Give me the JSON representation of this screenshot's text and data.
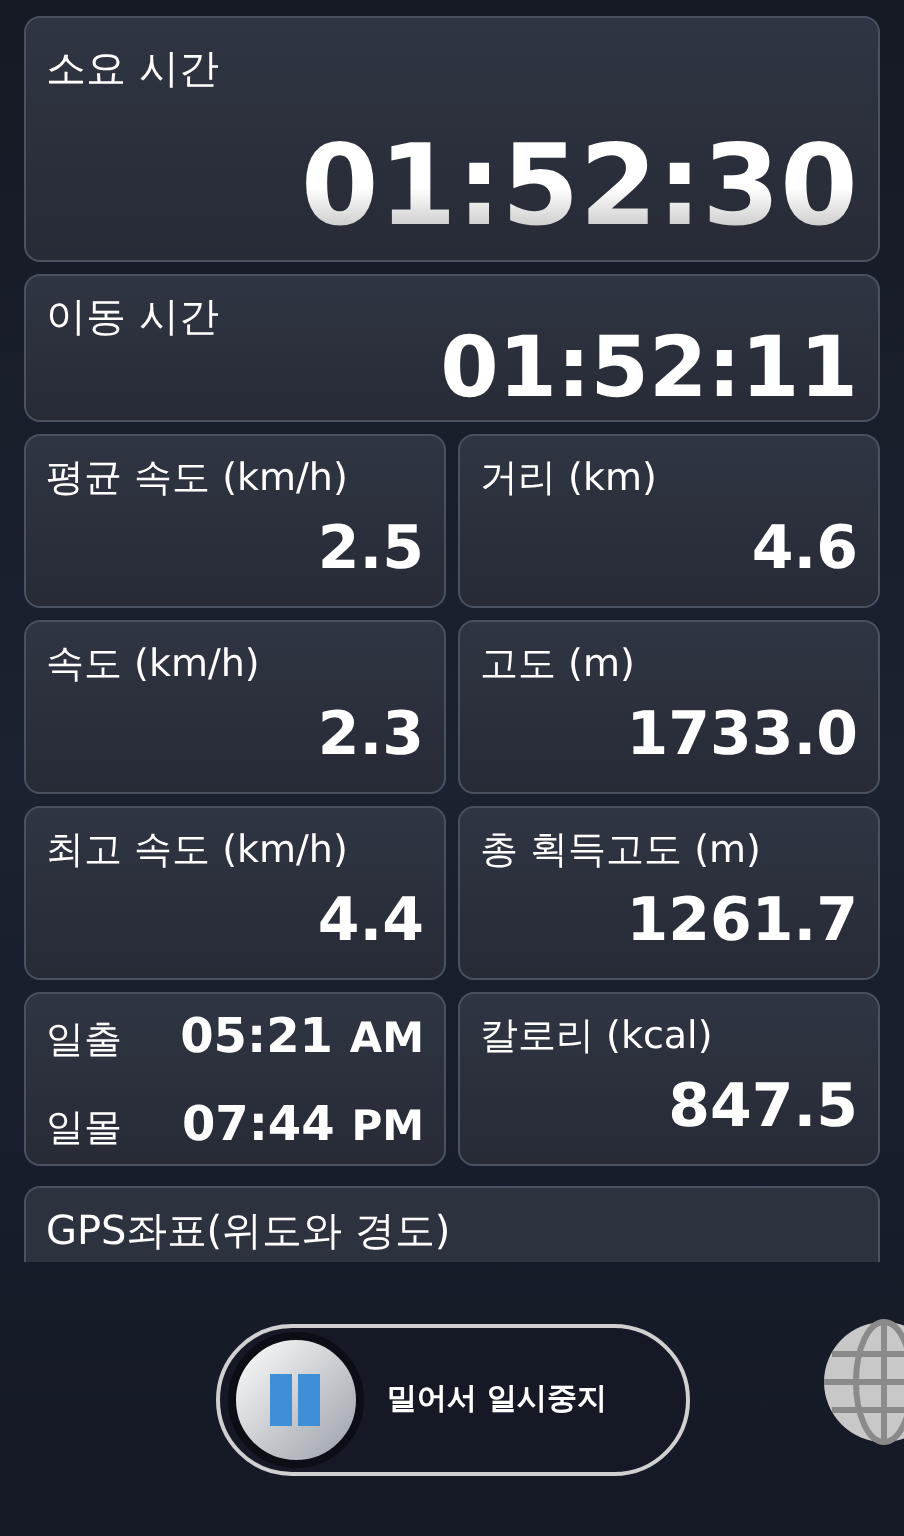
{
  "elapsed_time": {
    "label": "소요 시간",
    "value": "01:52:30"
  },
  "moving_time": {
    "label": "이동 시간",
    "value": "01:52:11"
  },
  "stats": [
    {
      "kind": "stat",
      "label": "평균 속도 (km/h)",
      "value": "2.5"
    },
    {
      "kind": "stat",
      "label": "거리 (km)",
      "value": "4.6"
    },
    {
      "kind": "stat",
      "label": "속도 (km/h)",
      "value": "2.3"
    },
    {
      "kind": "stat",
      "label": "고도 (m)",
      "value": "1733.0"
    },
    {
      "kind": "stat",
      "label": "최고 속도 (km/h)",
      "value": "4.4"
    },
    {
      "kind": "stat",
      "label": "총 획득고도 (m)",
      "value": "1261.7"
    },
    {
      "kind": "sun",
      "rows": [
        {
          "label": "일출",
          "time": "05:21",
          "period": "AM"
        },
        {
          "label": "일몰",
          "time": "07:44",
          "period": "PM"
        }
      ]
    },
    {
      "kind": "stat",
      "label": "칼로리 (kcal)",
      "value": "847.5"
    }
  ],
  "gps": {
    "label": "GPS좌표(위도와 경도)"
  },
  "pause_slider": {
    "label": "밀어서 일시중지"
  }
}
